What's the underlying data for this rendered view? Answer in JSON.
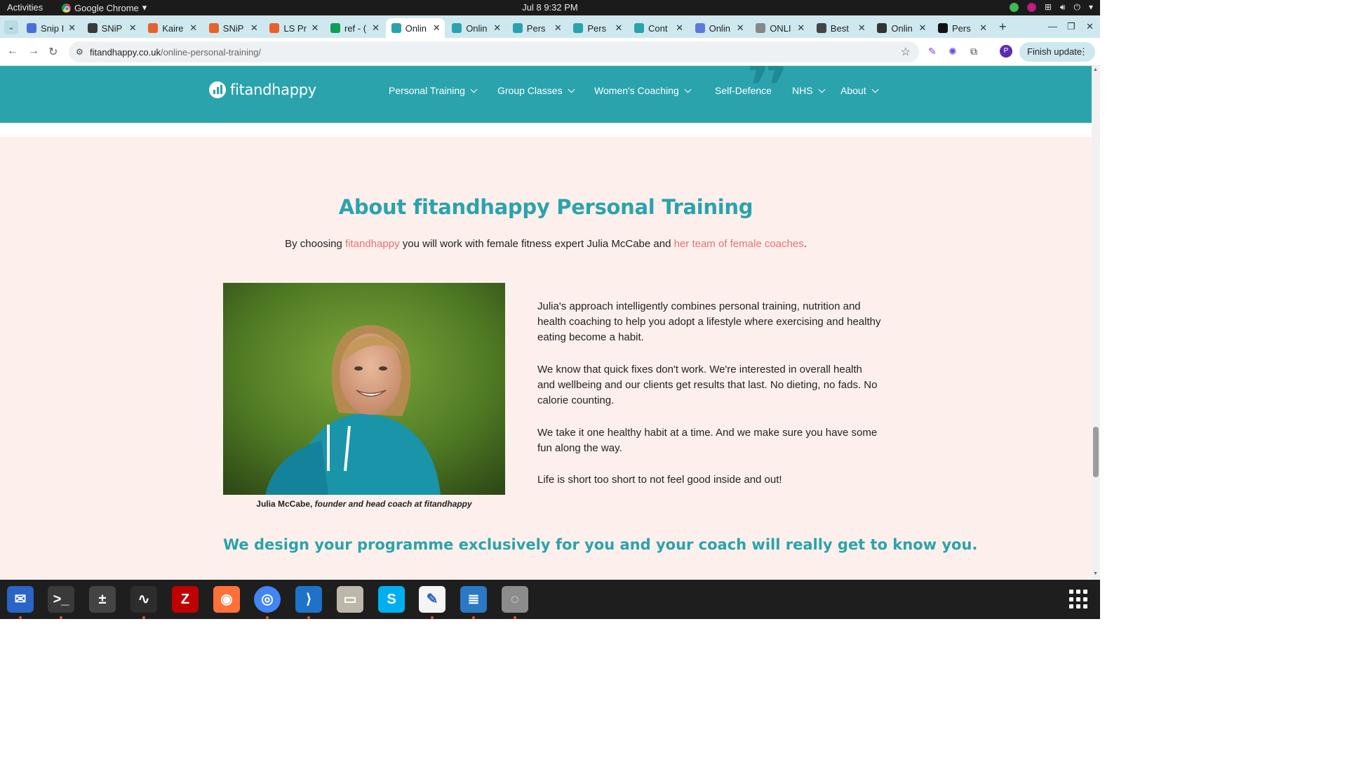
{
  "topbar": {
    "activities": "Activities",
    "app_name": "Google Chrome",
    "clock": "Jul 8  9:32 PM"
  },
  "tabs": [
    {
      "title": "Snip I",
      "color": "#4a6fd6"
    },
    {
      "title": "SNiP",
      "color": "#3a3a3a"
    },
    {
      "title": "Kaire",
      "color": "#e8612c"
    },
    {
      "title": "SNiP",
      "color": "#e8612c"
    },
    {
      "title": "LS Pr",
      "color": "#e8612c"
    },
    {
      "title": "ref - (",
      "color": "#0f9d58"
    },
    {
      "title": "Onlin",
      "color": "#2aa3ad",
      "active": true
    },
    {
      "title": "Onlin",
      "color": "#2aa3ad"
    },
    {
      "title": "Pers",
      "color": "#2aa3ad"
    },
    {
      "title": "Pers",
      "color": "#2aa3ad"
    },
    {
      "title": "Cont",
      "color": "#2aa3ad"
    },
    {
      "title": "Onlin",
      "color": "#5a7bd8"
    },
    {
      "title": "ONLI",
      "color": "#888888"
    },
    {
      "title": "Best",
      "color": "#444444"
    },
    {
      "title": "Onlin",
      "color": "#333333"
    },
    {
      "title": "Pers",
      "color": "#111111"
    }
  ],
  "address_bar": {
    "domain": "fitandhappy.co.uk",
    "path": "/online-personal-training/",
    "finish_update": "Finish update",
    "profile_initial": "P"
  },
  "site": {
    "logo": "fitandhappy",
    "nav": [
      "Personal Training",
      "Group Classes",
      "Women's Coaching",
      "Self-Defence",
      "NHS",
      "About"
    ],
    "accent_color": "#2aa3ad",
    "link_color": "#ee6f6f",
    "background": "#fdf0ec"
  },
  "about": {
    "title": "About fitandhappy Personal Training",
    "intro_before": "By choosing ",
    "intro_link1": "fitandhappy",
    "intro_middle": " you will work with female fitness expert Julia McCabe and ",
    "intro_link2": "her team of female coaches",
    "intro_after": ".",
    "caption_name": "Julia McCabe,",
    "caption_role": " founder and head coach at fitandhappy",
    "paragraphs": [
      "Julia's approach intelligently combines personal training, nutrition and health coaching to help you adopt a lifestyle where exercising and healthy eating become a habit.",
      "We know that quick fixes don't work. We're interested in overall health and wellbeing and our clients get results that last. No dieting, no fads. No calorie counting.",
      "We take it one healthy habit at a time. And we make sure you have some fun along the way.",
      "Life is short too short to not feel good inside and out!"
    ],
    "subheading": "We design your programme exclusively for you and your coach will really get to know you."
  },
  "dock": [
    {
      "name": "thunderbird",
      "color": "#2a64c5"
    },
    {
      "name": "terminal",
      "color": "#3a3a3a"
    },
    {
      "name": "calculator",
      "color": "#444444"
    },
    {
      "name": "system-monitor",
      "color": "#2d2d2d"
    },
    {
      "name": "filezilla",
      "color": "#bf0000"
    },
    {
      "name": "firefox",
      "color": "#ff7139"
    },
    {
      "name": "chrome",
      "color": "#4285f4"
    },
    {
      "name": "vscode",
      "color": "#1e73c8"
    },
    {
      "name": "files",
      "color": "#bdb7aa"
    },
    {
      "name": "skype",
      "color": "#00aff0"
    },
    {
      "name": "text-editor",
      "color": "#f5f5f5"
    },
    {
      "name": "libreoffice-writer",
      "color": "#2b78c5"
    },
    {
      "name": "disk-utility",
      "color": "#8c8c8c"
    }
  ]
}
